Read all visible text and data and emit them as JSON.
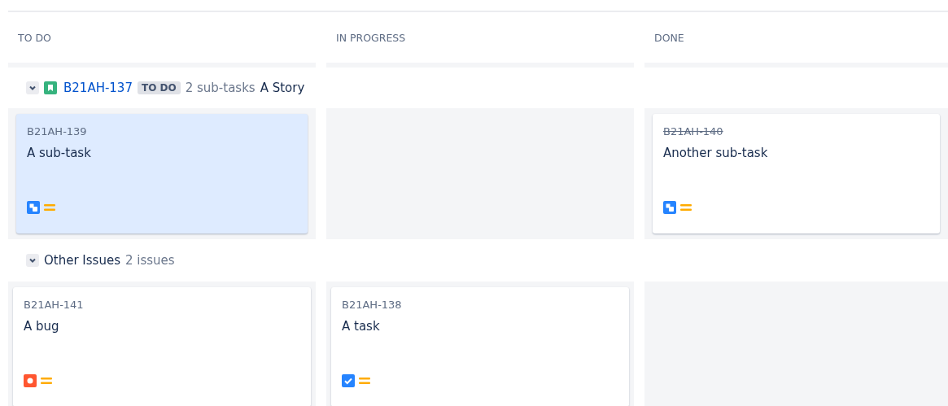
{
  "columns": [
    {
      "title": "TO DO"
    },
    {
      "title": "IN PROGRESS"
    },
    {
      "title": "DONE"
    }
  ],
  "swimlanes": [
    {
      "kind": "story",
      "expanded": true,
      "key": "B21AH-137",
      "status": "TO DO",
      "count": "2 sub-tasks",
      "summary": "A Story",
      "cells": [
        [
          {
            "key": "B21AH-139",
            "summary": "A sub-task",
            "kind": "subtask",
            "selected": true,
            "done": false
          }
        ],
        [],
        [
          {
            "key": "B21AH-140",
            "summary": "Another sub-task",
            "kind": "subtask",
            "selected": false,
            "done": true
          }
        ]
      ]
    },
    {
      "kind": "group",
      "expanded": true,
      "title": "Other Issues",
      "count": "2 issues",
      "cells": [
        [
          {
            "key": "B21AH-141",
            "summary": "A bug",
            "kind": "bug",
            "selected": false,
            "done": false
          }
        ],
        [
          {
            "key": "B21AH-138",
            "summary": "A task",
            "kind": "task",
            "selected": false,
            "done": false
          }
        ],
        []
      ]
    }
  ]
}
